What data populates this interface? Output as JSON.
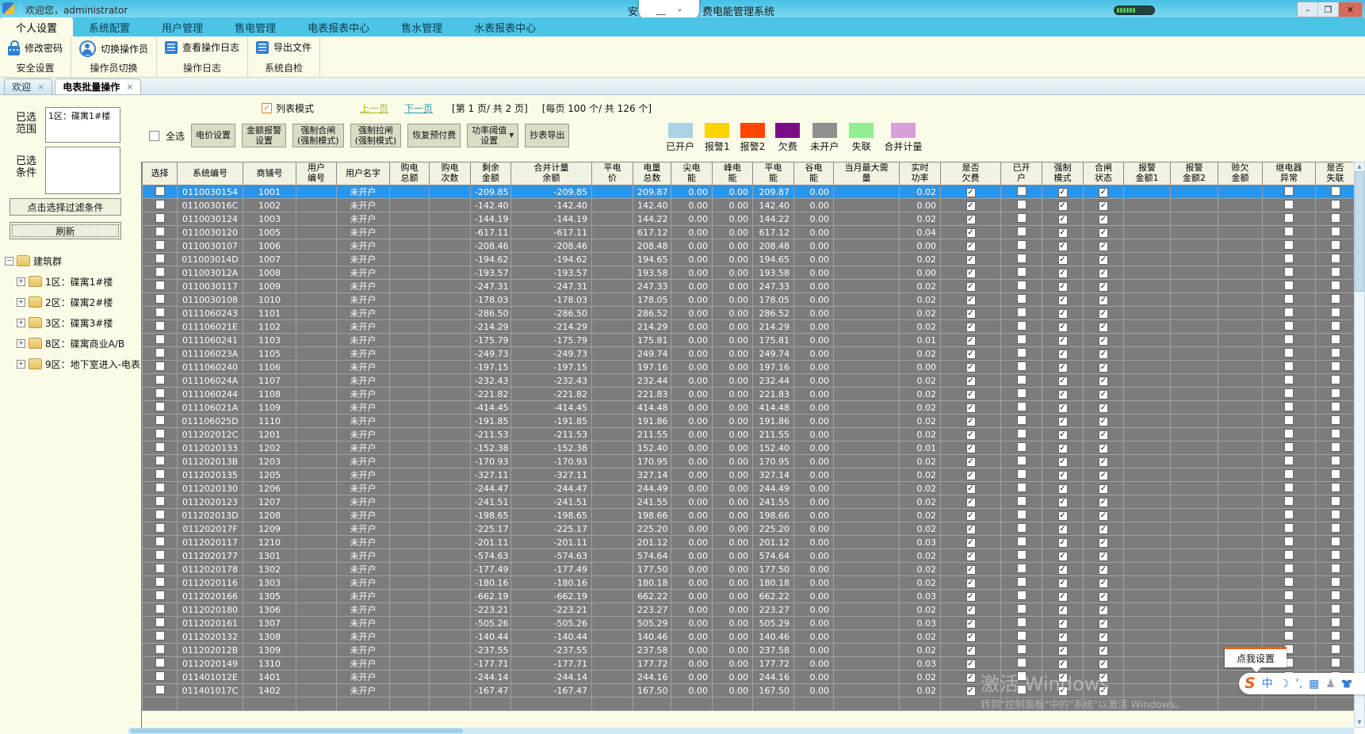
{
  "titlebar": {
    "welcome": "欢迎您，administrator",
    "title_prefix": "安",
    "title_suffix": "费电能管理系统",
    "minimize": "–",
    "maximize": "❐",
    "close": "✕",
    "recorder_minimize": "—",
    "recorder_expand": "˅"
  },
  "menu": {
    "items": [
      {
        "label": "个人设置",
        "active": true
      },
      {
        "label": "系统配置",
        "active": false
      },
      {
        "label": "用户管理",
        "active": false
      },
      {
        "label": "售电管理",
        "active": false
      },
      {
        "label": "电表报表中心",
        "active": false
      },
      {
        "label": "售水管理",
        "active": false
      },
      {
        "label": "水表报表中心",
        "active": false
      }
    ]
  },
  "ribbon": {
    "groups": [
      {
        "button": "修改密码",
        "icon": "lock-icon",
        "label": "安全设置"
      },
      {
        "button": "切换操作员",
        "icon": "operator-icon",
        "label": "操作员切换"
      },
      {
        "button": "查看操作日志",
        "icon": "log-icon",
        "label": "操作日志"
      },
      {
        "button": "导出文件",
        "icon": "export-icon",
        "label": "系统自检"
      }
    ]
  },
  "tabs": [
    {
      "label": "欢迎",
      "active": false,
      "close": "×"
    },
    {
      "label": "电表批量操作",
      "active": true,
      "close": "×"
    }
  ],
  "sidebar": {
    "selected_range_label": "已选\n范围",
    "selected_range_value": "1区：碟寓1#楼",
    "selected_condition_label": "已选\n条件",
    "selected_condition_value": "",
    "filter_button": "点击选择过滤条件",
    "refresh_button": "刷新",
    "tree": {
      "root": "建筑群",
      "root_expander": "−",
      "child_expander": "+",
      "children": [
        "1区：碟寓1#楼",
        "2区：碟寓2#楼",
        "3区：碟寓3#楼",
        "8区：碟寓商业A/B",
        "9区：地下室进入-电表"
      ]
    }
  },
  "toolbar": {
    "list_mode_label": "列表模式",
    "prev_page": "上一页",
    "next_page": "下一页",
    "page_info": "[第  1 页/ 共  2 页]",
    "count_info": "[每页 100 个/ 共  126 个]",
    "select_all_label": "全选",
    "buttons": [
      {
        "label": "电价设置",
        "dropdown": false
      },
      {
        "label": "金额报警\n设置",
        "dropdown": false
      },
      {
        "label": "强制合闸\n(强制模式)",
        "dropdown": false
      },
      {
        "label": "强制拉闸\n(强制模式)",
        "dropdown": false
      },
      {
        "label": "恢复预付费",
        "dropdown": false
      },
      {
        "label": "功率阈值\n设置",
        "dropdown": true
      },
      {
        "label": "抄表导出",
        "dropdown": false
      }
    ]
  },
  "legend": [
    {
      "label": "已开户",
      "color": "#a9d3e4"
    },
    {
      "label": "报警1",
      "color": "#ffd400"
    },
    {
      "label": "报警2",
      "color": "#ff4500"
    },
    {
      "label": "欠费",
      "color": "#7b0e86"
    },
    {
      "label": "未开户",
      "color": "#8f8f8f"
    },
    {
      "label": "失联",
      "color": "#90ee90"
    },
    {
      "label": "合并计量",
      "color": "#d8a0d8"
    }
  ],
  "table": {
    "headers": [
      "选择",
      "系统编号",
      "商铺号",
      "用户\n编号",
      "用户名字",
      "购电\n总额",
      "购电\n次数",
      "剩余\n金额",
      "合并计量\n余额",
      "平电\n价",
      "电量\n总数",
      "尖电\n能",
      "峰电\n能",
      "平电\n能",
      "谷电\n能",
      "当月最大需\n量",
      "实时\n功率",
      "是否\n欠费",
      "已开\n户",
      "强制\n模式",
      "合闸\n状态",
      "报警\n金额1",
      "报警\n金额2",
      "赊欠\n金额",
      "继电器\n异常",
      "是否\n失联"
    ],
    "row_fields": [
      "system_id",
      "shop_no",
      "remaining_amount",
      "merged_metering_balance",
      "total_energy",
      "flat_energy",
      "realtime_power"
    ],
    "constants": {
      "user_name": "未开户",
      "zero": "0.00"
    },
    "checks": {
      "owe": true,
      "opened": false,
      "forced": true,
      "closed": true,
      "relay": false,
      "lost": false
    },
    "selected_index": 0,
    "rows": [
      [
        "0110030154",
        "1001",
        "-209.85",
        "-209.85",
        "209.87",
        "209.87",
        "0.02"
      ],
      [
        "011003016C",
        "1002",
        "-142.40",
        "-142.40",
        "142.40",
        "142.40",
        "0.00"
      ],
      [
        "0110030124",
        "1003",
        "-144.19",
        "-144.19",
        "144.22",
        "144.22",
        "0.02"
      ],
      [
        "0110030120",
        "1005",
        "-617.11",
        "-617.11",
        "617.12",
        "617.12",
        "0.04"
      ],
      [
        "0110030107",
        "1006",
        "-208.46",
        "-208.46",
        "208.48",
        "208.48",
        "0.00"
      ],
      [
        "011003014D",
        "1007",
        "-194.62",
        "-194.62",
        "194.65",
        "194.65",
        "0.02"
      ],
      [
        "011003012A",
        "1008",
        "-193.57",
        "-193.57",
        "193.58",
        "193.58",
        "0.00"
      ],
      [
        "0110030117",
        "1009",
        "-247.31",
        "-247.31",
        "247.33",
        "247.33",
        "0.02"
      ],
      [
        "0110030108",
        "1010",
        "-178.03",
        "-178.03",
        "178.05",
        "178.05",
        "0.02"
      ],
      [
        "0111060243",
        "1101",
        "-286.50",
        "-286.50",
        "286.52",
        "286.52",
        "0.02"
      ],
      [
        "011106021E",
        "1102",
        "-214.29",
        "-214.29",
        "214.29",
        "214.29",
        "0.02"
      ],
      [
        "0111060241",
        "1103",
        "-175.79",
        "-175.79",
        "175.81",
        "175.81",
        "0.01"
      ],
      [
        "011106023A",
        "1105",
        "-249.73",
        "-249.73",
        "249.74",
        "249.74",
        "0.02"
      ],
      [
        "0111060240",
        "1106",
        "-197.15",
        "-197.15",
        "197.16",
        "197.16",
        "0.00"
      ],
      [
        "011106024A",
        "1107",
        "-232.43",
        "-232.43",
        "232.44",
        "232.44",
        "0.02"
      ],
      [
        "0111060244",
        "1108",
        "-221.82",
        "-221.82",
        "221.83",
        "221.83",
        "0.02"
      ],
      [
        "011106021A",
        "1109",
        "-414.45",
        "-414.45",
        "414.48",
        "414.48",
        "0.02"
      ],
      [
        "011106025D",
        "1110",
        "-191.85",
        "-191.85",
        "191.86",
        "191.86",
        "0.02"
      ],
      [
        "011202012C",
        "1201",
        "-211.53",
        "-211.53",
        "211.55",
        "211.55",
        "0.02"
      ],
      [
        "0112020133",
        "1202",
        "-152.38",
        "-152.38",
        "152.40",
        "152.40",
        "0.01"
      ],
      [
        "011202013B",
        "1203",
        "-170.93",
        "-170.93",
        "170.95",
        "170.95",
        "0.02"
      ],
      [
        "0112020135",
        "1205",
        "-327.11",
        "-327.11",
        "327.14",
        "327.14",
        "0.02"
      ],
      [
        "0112020130",
        "1206",
        "-244.47",
        "-244.47",
        "244.49",
        "244.49",
        "0.02"
      ],
      [
        "0112020123",
        "1207",
        "-241.51",
        "-241.51",
        "241.55",
        "241.55",
        "0.02"
      ],
      [
        "011202013D",
        "1208",
        "-198.65",
        "-198.65",
        "198.66",
        "198.66",
        "0.02"
      ],
      [
        "011202017F",
        "1209",
        "-225.17",
        "-225.17",
        "225.20",
        "225.20",
        "0.02"
      ],
      [
        "0112020117",
        "1210",
        "-201.11",
        "-201.11",
        "201.12",
        "201.12",
        "0.03"
      ],
      [
        "0112020177",
        "1301",
        "-574.63",
        "-574.63",
        "574.64",
        "574.64",
        "0.02"
      ],
      [
        "0112020178",
        "1302",
        "-177.49",
        "-177.49",
        "177.50",
        "177.50",
        "0.02"
      ],
      [
        "0112020116",
        "1303",
        "-180.16",
        "-180.16",
        "180.18",
        "180.18",
        "0.02"
      ],
      [
        "0112020166",
        "1305",
        "-662.19",
        "-662.19",
        "662.22",
        "662.22",
        "0.03"
      ],
      [
        "0112020180",
        "1306",
        "-223.21",
        "-223.21",
        "223.27",
        "223.27",
        "0.02"
      ],
      [
        "0112020161",
        "1307",
        "-505.26",
        "-505.26",
        "505.29",
        "505.29",
        "0.03"
      ],
      [
        "0112020132",
        "1308",
        "-140.44",
        "-140.44",
        "140.46",
        "140.46",
        "0.02"
      ],
      [
        "011202012B",
        "1309",
        "-237.55",
        "-237.55",
        "237.58",
        "237.58",
        "0.02"
      ],
      [
        "0112020149",
        "1310",
        "-177.71",
        "-177.71",
        "177.72",
        "177.72",
        "0.03"
      ],
      [
        "011401012E",
        "1401",
        "-244.14",
        "-244.14",
        "244.16",
        "244.16",
        "0.02"
      ],
      [
        "011401017C",
        "1402",
        "-167.47",
        "-167.47",
        "167.50",
        "167.50",
        "0.02"
      ]
    ]
  },
  "overlays": {
    "tooltip": "点我设置",
    "watermark_line1": "激活 Windows",
    "watermark_line2": "转到\"控制面板\"中的\"系统\"以激活 Windows。",
    "ime_icons": [
      "sogou-logo",
      "chinese-mode",
      "moon",
      "punctuation",
      "soft-keyboard",
      "user",
      "skin"
    ],
    "ime_chinese_mode_glyph": "中"
  }
}
